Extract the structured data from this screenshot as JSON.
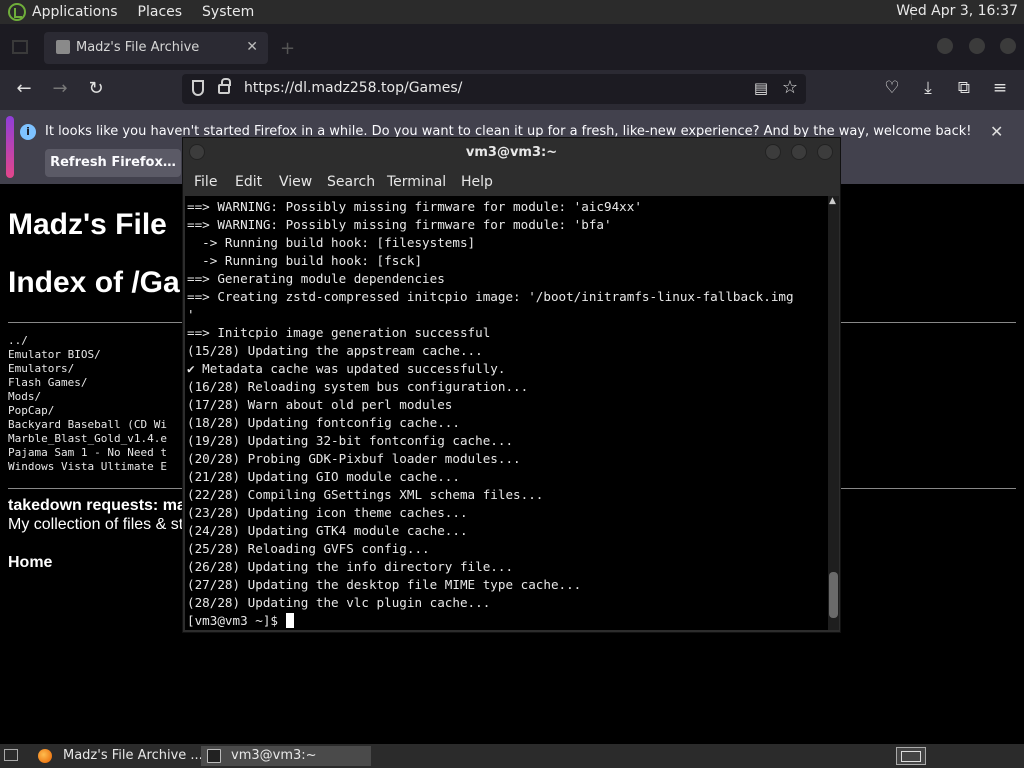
{
  "panel": {
    "menus": [
      "Applications",
      "Places",
      "System"
    ],
    "clock": "Wed Apr  3, 16:37"
  },
  "browser": {
    "tab_title": "Madz's File Archive",
    "url": "https://dl.madz258.top/Games/",
    "notification": {
      "text": "It looks like you haven't started Firefox in a while. Do you want to clean it up for a fresh, like-new experience? And by the way, welcome back!",
      "button": "Refresh Firefox…"
    }
  },
  "page": {
    "site_title": "Madz's File",
    "index_title": "Index of /Ga",
    "listing": [
      "../",
      "Emulator BIOS/",
      "Emulators/",
      "Flash Games/",
      "Mods/",
      "PopCap/",
      "Backyard Baseball (CD Wi",
      "Marble_Blast_Gold_v1.4.e",
      "Pajama Sam 1 - No Need t",
      "Windows Vista Ultimate E"
    ],
    "takedown": "takedown requests: ma",
    "collection": "My collection of files & st",
    "home": "Home"
  },
  "terminal": {
    "title": "vm3@vm3:~",
    "menu": [
      "File",
      "Edit",
      "View",
      "Search",
      "Terminal",
      "Help"
    ],
    "lines": [
      "==> WARNING: Possibly missing firmware for module: 'aic94xx'",
      "==> WARNING: Possibly missing firmware for module: 'bfa'",
      "  -> Running build hook: [filesystems]",
      "  -> Running build hook: [fsck]",
      "==> Generating module dependencies",
      "==> Creating zstd-compressed initcpio image: '/boot/initramfs-linux-fallback.img",
      "'",
      "==> Initcpio image generation successful",
      "(15/28) Updating the appstream cache...",
      "✔ Metadata cache was updated successfully.",
      "(16/28) Reloading system bus configuration...",
      "(17/28) Warn about old perl modules",
      "(18/28) Updating fontconfig cache...",
      "(19/28) Updating 32-bit fontconfig cache...",
      "(20/28) Probing GDK-Pixbuf loader modules...",
      "(21/28) Updating GIO module cache...",
      "(22/28) Compiling GSettings XML schema files...",
      "(23/28) Updating icon theme caches...",
      "(24/28) Updating GTK4 module cache...",
      "(25/28) Reloading GVFS config...",
      "(26/28) Updating the info directory file...",
      "(27/28) Updating the desktop file MIME type cache...",
      "(28/28) Updating the vlc plugin cache..."
    ],
    "prompt": "[vm3@vm3 ~]$ "
  },
  "taskbar": {
    "tasks": [
      "Madz's File Archive ...",
      "vm3@vm3:~"
    ]
  }
}
